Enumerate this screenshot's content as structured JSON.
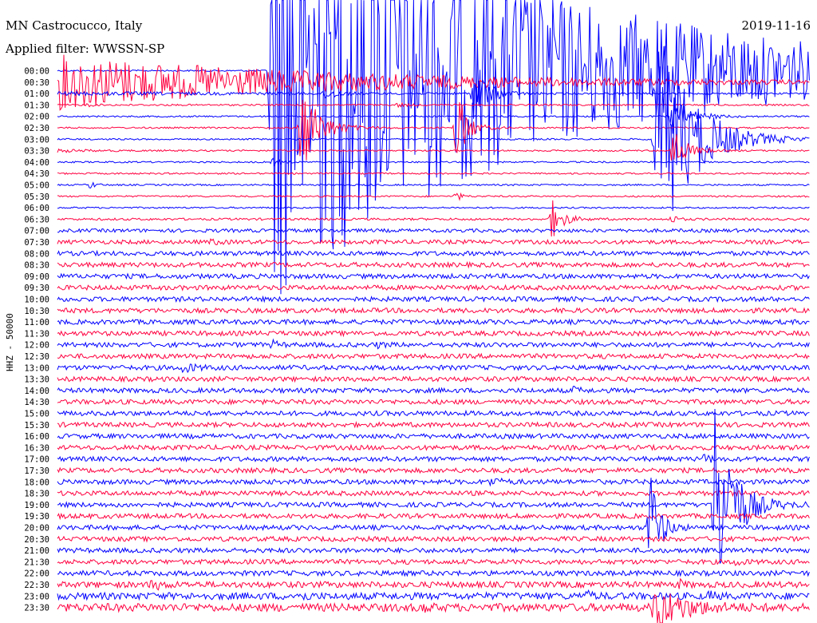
{
  "header": {
    "station": "MN Castrocucco, Italy",
    "date": "2019-11-16",
    "filter": "Applied filter: WWSSN-SP"
  },
  "axis": {
    "channel_label": "HHZ - 50000"
  },
  "colors": {
    "trace_a": "#0000ff",
    "trace_b": "#ff0040",
    "background": "#ffffff",
    "text": "#000000"
  },
  "chart_data": {
    "type": "line",
    "title": "MN Castrocucco, Italy",
    "date": "2019-11-16",
    "filter": "WWSSN-SP",
    "ylabel": "HHZ - 50000",
    "row_labels": [
      "00:00",
      "00:30",
      "01:00",
      "01:30",
      "02:00",
      "02:30",
      "03:00",
      "03:30",
      "04:00",
      "04:30",
      "05:00",
      "05:30",
      "06:00",
      "06:30",
      "07:00",
      "07:30",
      "08:00",
      "08:30",
      "09:00",
      "09:30",
      "10:00",
      "10:30",
      "11:00",
      "11:30",
      "12:00",
      "12:30",
      "13:00",
      "13:30",
      "14:00",
      "14:30",
      "15:00",
      "15:30",
      "16:00",
      "16:30",
      "17:00",
      "17:30",
      "18:00",
      "18:30",
      "19:00",
      "19:30",
      "20:00",
      "20:30",
      "21:00",
      "21:30",
      "22:00",
      "22:30",
      "23:00",
      "23:30"
    ],
    "row_minutes": 30,
    "alternating_colors": [
      "#0000ff",
      "#ff0040"
    ],
    "grid": false,
    "noise_amplitude_by_row": [
      1,
      1,
      1,
      1,
      1,
      1,
      1,
      1,
      1,
      1,
      1,
      1,
      1,
      1.4,
      2.2,
      2.6,
      2.8,
      3,
      3,
      3,
      3,
      3,
      3,
      3,
      3,
      3,
      3,
      3,
      3,
      3,
      3,
      3,
      3,
      3,
      3,
      3,
      3,
      3,
      3,
      3,
      3,
      3,
      3,
      3,
      3.2,
      3.8,
      4.4,
      5
    ],
    "events": [
      {
        "row": 0,
        "minute": 8.5,
        "amplitude": 300,
        "duration_min": 30
      },
      {
        "row": 2,
        "minute": 10.7,
        "amplitude": 10,
        "duration_min": 1
      },
      {
        "row": 2,
        "minute": 16.6,
        "amplitude": 40,
        "duration_min": 1.5
      },
      {
        "row": 3,
        "minute": 13.6,
        "amplitude": 3,
        "duration_min": 0.8
      },
      {
        "row": 3,
        "minute": 1.2,
        "amplitude": 2,
        "duration_min": 0.5
      },
      {
        "row": 4,
        "minute": 24.5,
        "amplitude": 25,
        "duration_min": 2
      },
      {
        "row": 5,
        "minute": 9.7,
        "amplitude": 60,
        "duration_min": 2
      },
      {
        "row": 5,
        "minute": 15.9,
        "amplitude": 50,
        "duration_min": 1.2
      },
      {
        "row": 6,
        "minute": 23.8,
        "amplitude": 160,
        "duration_min": 4
      },
      {
        "row": 7,
        "minute": 24.5,
        "amplitude": 30,
        "duration_min": 1.5
      },
      {
        "row": 8,
        "minute": 8.6,
        "amplitude": 4,
        "duration_min": 0.8
      },
      {
        "row": 10,
        "minute": 1.3,
        "amplitude": 5,
        "duration_min": 0.6
      },
      {
        "row": 11,
        "minute": 15.9,
        "amplitude": 6,
        "duration_min": 0.6
      },
      {
        "row": 13,
        "minute": 19.7,
        "amplitude": 25,
        "duration_min": 1.2
      },
      {
        "row": 13,
        "minute": 24.5,
        "amplitude": 5,
        "duration_min": 0.6
      },
      {
        "row": 15,
        "minute": 6.2,
        "amplitude": 4,
        "duration_min": 0.6
      },
      {
        "row": 24,
        "minute": 8.6,
        "amplitude": 4,
        "duration_min": 0.6
      },
      {
        "row": 24,
        "minute": 12.8,
        "amplitude": 3,
        "duration_min": 0.6
      },
      {
        "row": 26,
        "minute": 5.0,
        "amplitude": 5,
        "duration_min": 1.5
      },
      {
        "row": 28,
        "minute": 20.6,
        "amplitude": 4,
        "duration_min": 0.6
      },
      {
        "row": 34,
        "minute": 25.8,
        "amplitude": 6,
        "duration_min": 0.6
      },
      {
        "row": 36,
        "minute": 17.2,
        "amplitude": 4,
        "duration_min": 1.5
      },
      {
        "row": 38,
        "minute": 26.2,
        "amplitude": 150,
        "duration_min": 2
      },
      {
        "row": 40,
        "minute": 23.6,
        "amplitude": 80,
        "duration_min": 1
      },
      {
        "row": 43,
        "minute": 27.0,
        "amplitude": 5,
        "duration_min": 0.6
      },
      {
        "row": 45,
        "minute": 3.8,
        "amplitude": 5,
        "duration_min": 1.2
      },
      {
        "row": 45,
        "minute": 24.8,
        "amplitude": 4,
        "duration_min": 0.6
      },
      {
        "row": 46,
        "minute": 9.7,
        "amplitude": 5,
        "duration_min": 0.6
      },
      {
        "row": 46,
        "minute": 21.0,
        "amplitude": 5,
        "duration_min": 0.8
      },
      {
        "row": 46,
        "minute": 26.0,
        "amplitude": 4,
        "duration_min": 0.6
      },
      {
        "row": 47,
        "minute": 14.6,
        "amplitude": 5,
        "duration_min": 0.6
      },
      {
        "row": 47,
        "minute": 23.8,
        "amplitude": 30,
        "duration_min": 3
      }
    ]
  }
}
